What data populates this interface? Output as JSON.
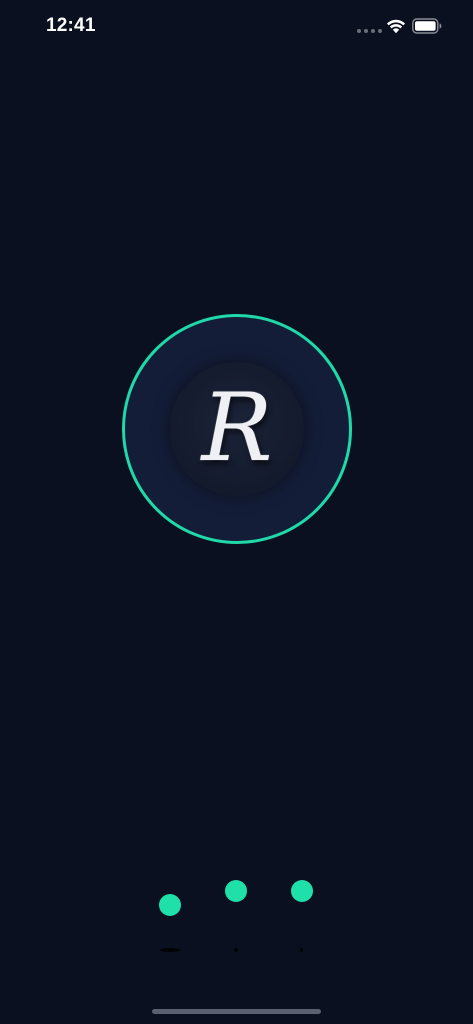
{
  "status_bar": {
    "time": "12:41",
    "wifi_icon": "wifi-icon",
    "battery_icon": "battery-icon",
    "signal_icon": "signal-dots-icon"
  },
  "logo": {
    "letter": "R",
    "ring_color": "#1fd9a8",
    "background_color": "#141d38"
  },
  "loader": {
    "dot_color": "#1fe0a8",
    "dot_count": 3
  },
  "colors": {
    "page_background": "#0a1020",
    "accent": "#1fe0a8"
  }
}
